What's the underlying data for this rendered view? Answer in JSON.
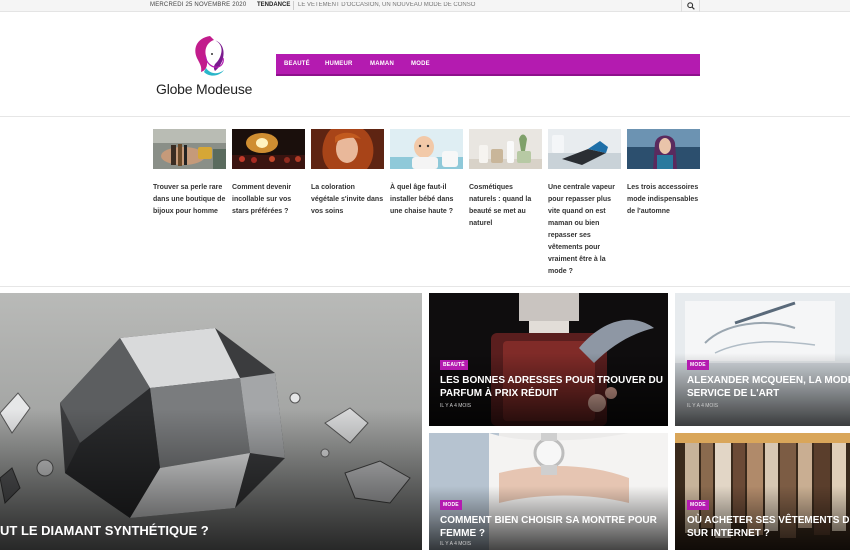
{
  "topbar": {
    "date": "MERCREDI 25 NOVEMBRE 2020",
    "trend_label": "TENDANCE",
    "trend_text": "LE VÊTEMENT D'OCCASION, UN NOUVEAU MODE DE CONSO",
    "search_icon": "search-icon"
  },
  "header": {
    "logo_text": "Globe Modeuse",
    "nav": [
      "BEAUTÉ",
      "HUMEUR",
      "MAMAN",
      "MODE"
    ]
  },
  "slider": [
    {
      "title": "Trouver sa perle rare dans une boutique de bijoux pour homme"
    },
    {
      "title": "Comment devenir incollable sur vos stars préférées ?"
    },
    {
      "title": "La coloration végétale s'invite dans vos soins"
    },
    {
      "title": "À quel âge faut-il installer bébé dans une chaise haute ?"
    },
    {
      "title": "Cosmétiques naturels : quand la beauté se met au naturel"
    },
    {
      "title": "Une centrale vapeur pour repasser plus vite quand on est maman ou bien repasser ses vêtements pour vraiment être à la mode ?"
    },
    {
      "title": "Les trois accessoires mode indispensables de l'automne"
    }
  ],
  "featured": {
    "big": {
      "title": "UT LE DIAMANT SYNTHÉTIQUE ?"
    },
    "items": [
      {
        "category": "BEAUTÉ",
        "title_line1": "LES BONNES ADRESSES POUR TROUVER DU",
        "title_line2": "PARFUM À PRIX RÉDUIT",
        "meta": "IL Y A 4 MOIS"
      },
      {
        "category": "MODE",
        "title_line1": "ALEXANDER MCQUEEN, LA MODE A",
        "title_line2": "SERVICE DE L'ART",
        "meta": "IL Y A 4 MOIS"
      },
      {
        "category": "MODE",
        "title_line1": "COMMENT BIEN CHOISIR SA MONTRE POUR",
        "title_line2": "FEMME ?",
        "meta": "IL Y A 4 MOIS"
      },
      {
        "category": "MODE",
        "title_line1": "OÙ ACHETER SES VÊTEMENTS D'O",
        "title_line2": "SUR INTERNET ?",
        "meta": ""
      }
    ]
  },
  "colors": {
    "accent": "#b41bb0"
  }
}
